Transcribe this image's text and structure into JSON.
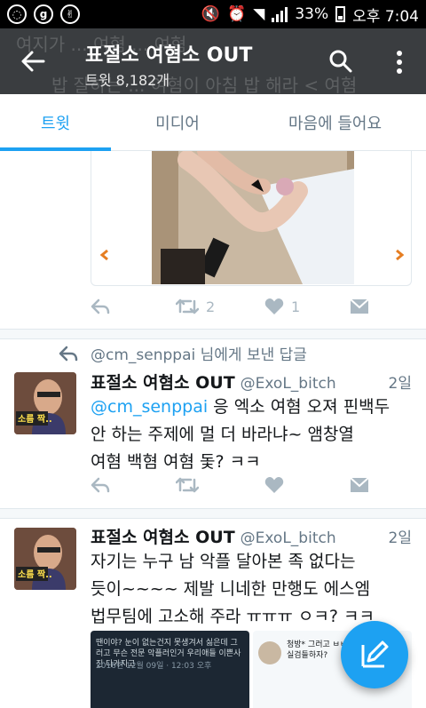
{
  "status_bar": {
    "battery": "33%",
    "time": "오후 7:04",
    "left_icons": [
      "chat-icon",
      "g-icon",
      "victory-icon"
    ]
  },
  "app_bar": {
    "title": "표절소 여혐소 OUT",
    "subtitle": "트윗 8,182개",
    "ghost_text_1": "여지가 ... 여혐 ... 여혐",
    "ghost_text_2": "밥 잘하는 ... 여혐이 아침 밥 해라 < 여혐"
  },
  "tabs": [
    "트윗",
    "미디어",
    "마음에 들어요"
  ],
  "tweets": [
    {
      "retweets": "2",
      "likes": "1"
    },
    {
      "reply_to": "@cm_senppai 님에게 보낸 답글",
      "name": "표절소 여혐소 OUT",
      "handle": "@ExoL_bitch",
      "time": "2일",
      "mention": "@cm_senppai",
      "text_line1": " 응 엑소 여혐 오져 핀백두",
      "text_line2": "안 하는 주제에 멀 더 바라냐~ 앰창열",
      "text_line3": "여혐 백혐 여혐 돛? ㅋㅋ",
      "avatar_label": "소름 짝.."
    },
    {
      "name": "표절소 여혐소 OUT",
      "handle": "@ExoL_bitch",
      "time": "2일",
      "text_line1": "자기는 누구 남 악플 달아본 족 없다는",
      "text_line2": "듯이~~~~ 제발 니네한 만행도 에스엠",
      "text_line3": "법무팀에 고소해 주라 ㅠㅠㅠ ㅇㅋ? ㅋㅋ",
      "avatar_label": "소름 짝..",
      "media_left_text": "땐이야? 눈이 없는건지 못생겨서 싫은데 그러고 무슨 전문 악플러인거 우리애들 이쁜사진 다가지고",
      "media_left_date": "2016년 12월 09일 · 12:03 오후",
      "media_right_text": "청방*  그러고 ㅂㅂ하랍 ㅇㅅ방 ... 실검들하자?"
    }
  ],
  "colors": {
    "accent": "#1da1f2",
    "appbar": "#3a3d40",
    "muted": "#657786"
  }
}
